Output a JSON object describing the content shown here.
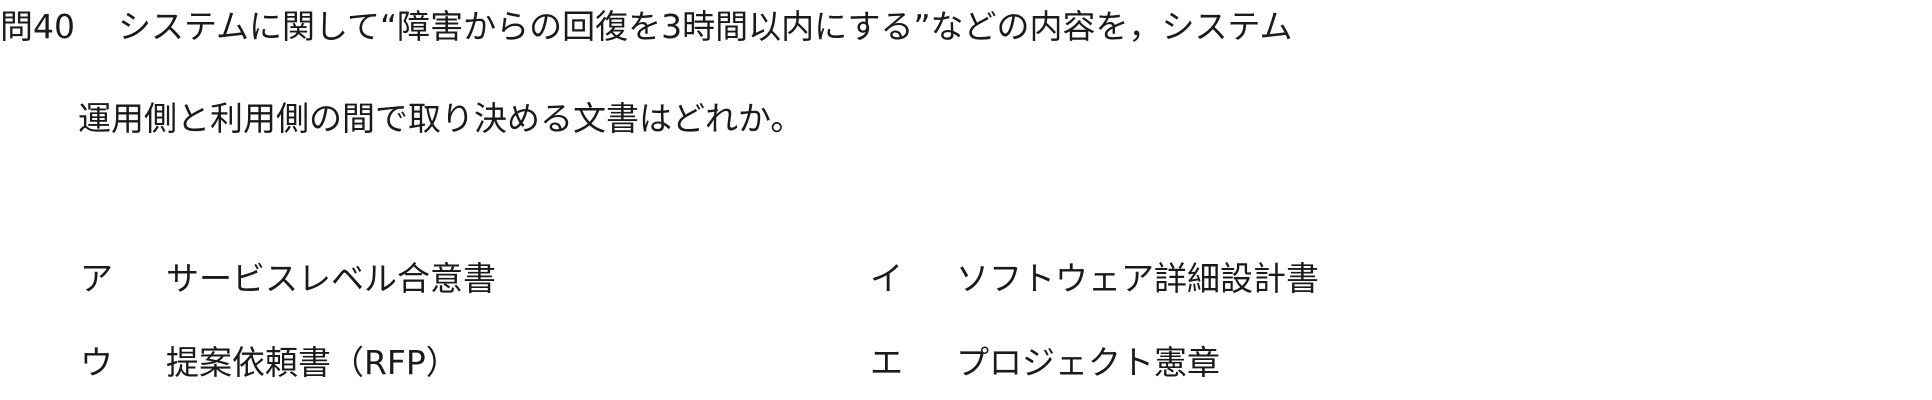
{
  "question": {
    "number": "問40",
    "line1": "システムに関して“障害からの回復を3時間以内にする”などの内容を，システム",
    "line2": "運用側と利用側の間で取り決める文書はどれか。"
  },
  "choices": [
    {
      "label": "ア",
      "text": "サービスレベル合意書"
    },
    {
      "label": "イ",
      "text": "ソフトウェア詳細設計書"
    },
    {
      "label": "ウ",
      "text": "提案依頼書（RFP）"
    },
    {
      "label": "エ",
      "text": "プロジェクト憲章"
    }
  ]
}
